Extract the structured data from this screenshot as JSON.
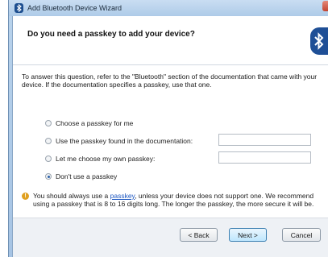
{
  "window": {
    "title": "Add Bluetooth Device Wizard"
  },
  "header": {
    "question": "Do you need a passkey to add your device?"
  },
  "description": "To answer this question, refer to the \"Bluetooth\" section of the documentation that came with your device. If the documentation specifies a passkey, use that one.",
  "options": [
    {
      "label": "Choose a passkey for me",
      "checked": false
    },
    {
      "label": "Use the passkey found in the documentation:",
      "checked": false,
      "value": ""
    },
    {
      "label": "Let me choose my own passkey:",
      "checked": false,
      "value": ""
    },
    {
      "label": "Don't use a passkey",
      "checked": true
    }
  ],
  "info": {
    "before_link": "You should always use a ",
    "link": "passkey",
    "after_link": ", unless your device does not support one. We recommend using a passkey that is 8 to 16 digits long. The longer the passkey, the more secure it will be."
  },
  "buttons": {
    "back": "< Back",
    "next": "Next >",
    "cancel": "Cancel"
  },
  "colors": {
    "bluetooth_blue": "#1f4f96",
    "link": "#1a55c0",
    "info_icon": "#e0a020"
  }
}
